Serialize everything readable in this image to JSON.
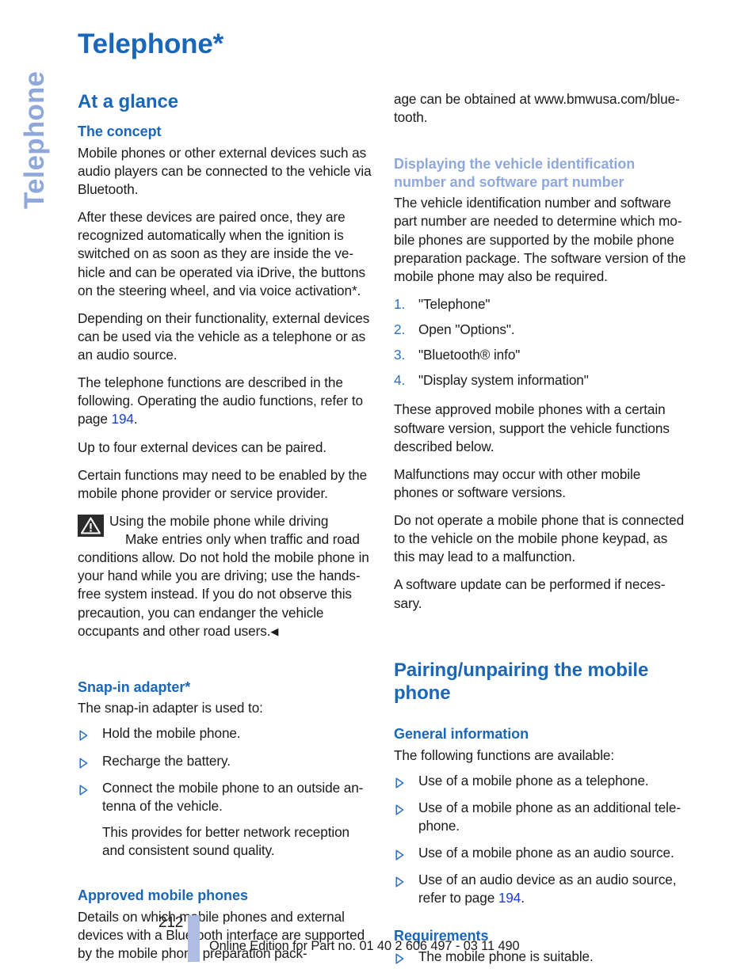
{
  "chapter_tab": {
    "label": "Telephone"
  },
  "page_title": "Telephone*",
  "colors": {
    "heading_blue": "#1a66b8",
    "muted_blue": "#8fa8db",
    "link_blue": "#1a3fe0",
    "number_blue": "#2c6fc4",
    "footer_bar_blue": "#aebde4",
    "warning_icon_bg": "#2b2b2b",
    "body_text": "#1b1b1b"
  },
  "left_column": {
    "section_heading": "At a glance",
    "concept": {
      "heading": "The concept",
      "p1": "Mobile phones or other external devices such as audio players can be connected to the vehicle via Bluetooth.",
      "p2": "After these devices are paired once, they are recognized automatically when the ignition is switched on as soon as they are inside the ve­hicle and can be operated via iDrive, the buttons on the steering wheel, and via voice activation*.",
      "p3": "Depending on their functionality, external devi­ces can be used via the vehicle as a telephone or as an audio source.",
      "p4_before_link": "The telephone functions are described in the following. Operating the audio functions, refer to page ",
      "p4_link": "194",
      "p4_after_link": ".",
      "p5": "Up to four external devices can be paired.",
      "p6": "Certain functions may need to be enabled by the mobile phone provider or service provider."
    },
    "warning": {
      "icon_name": "warning-triangle-icon",
      "title": "Using the mobile phone while driving",
      "body": "Make entries only when traffic and road conditions allow. Do not hold the mobile phone in your hand while you are driving; use the hands-free system instead. If you do not ob­serve this precaution, you can endanger the ve­hicle occupants and other road users.",
      "end_mark": "◀"
    },
    "snap_in": {
      "heading": "Snap-in adapter*",
      "intro": "The snap-in adapter is used to:",
      "bullets": [
        "Hold the mobile phone.",
        "Recharge the battery.",
        "Connect the mobile phone to an outside an­tenna of the vehicle."
      ],
      "note": "This provides for better network reception and consistent sound quality."
    },
    "approved": {
      "heading": "Approved mobile phones",
      "paragraph": "Details on which mobile phones and external devices with a Bluetooth interface are sup­ported by the mobile phone preparation pack-"
    }
  },
  "right_column": {
    "continuation": "age can be obtained at www.bmwusa.com/blue­tooth.",
    "displaying": {
      "heading": "Displaying the vehicle identification number and software part number",
      "paragraph": "The vehicle identification number and software part number are needed to determine which mo­bile phones are supported by the mobile phone preparation package. The software version of the mobile phone may also be required.",
      "steps": [
        {
          "num": "1.",
          "text": "\"Telephone\""
        },
        {
          "num": "2.",
          "text": "Open \"Options\"."
        },
        {
          "num": "3.",
          "text": "\"Bluetooth® info\""
        },
        {
          "num": "4.",
          "text": "\"Display system information\""
        }
      ],
      "p_after_1": "These approved mobile phones with a certain software version, support the vehicle functions described below.",
      "p_after_2": "Malfunctions may occur with other mobile phones or software versions.",
      "p_after_3": "Do not operate a mobile phone that is connected to the vehicle on the mobile phone keypad, as this may lead to a malfunction.",
      "p_after_4": "A software update can be performed if neces­sary."
    },
    "pairing": {
      "section_heading": "Pairing/unpairing the mobile phone",
      "general": {
        "heading": "General information",
        "intro": "The following functions are available:",
        "bullets": [
          {
            "text": "Use of a mobile phone as a telephone.",
            "link": null,
            "after": null
          },
          {
            "text": "Use of a mobile phone as an additional tele­phone.",
            "link": null,
            "after": null
          },
          {
            "text": "Use of a mobile phone as an audio source.",
            "link": null,
            "after": null
          },
          {
            "text": "Use of an audio device as an audio source, refer to page ",
            "link": "194",
            "after": "."
          }
        ]
      },
      "requirements": {
        "heading": "Requirements",
        "bullets": [
          "The mobile phone is suitable."
        ]
      }
    }
  },
  "footer": {
    "page_number": "212",
    "text": "Online Edition for Part no. 01 40 2 606 497 - 03 11 490"
  }
}
